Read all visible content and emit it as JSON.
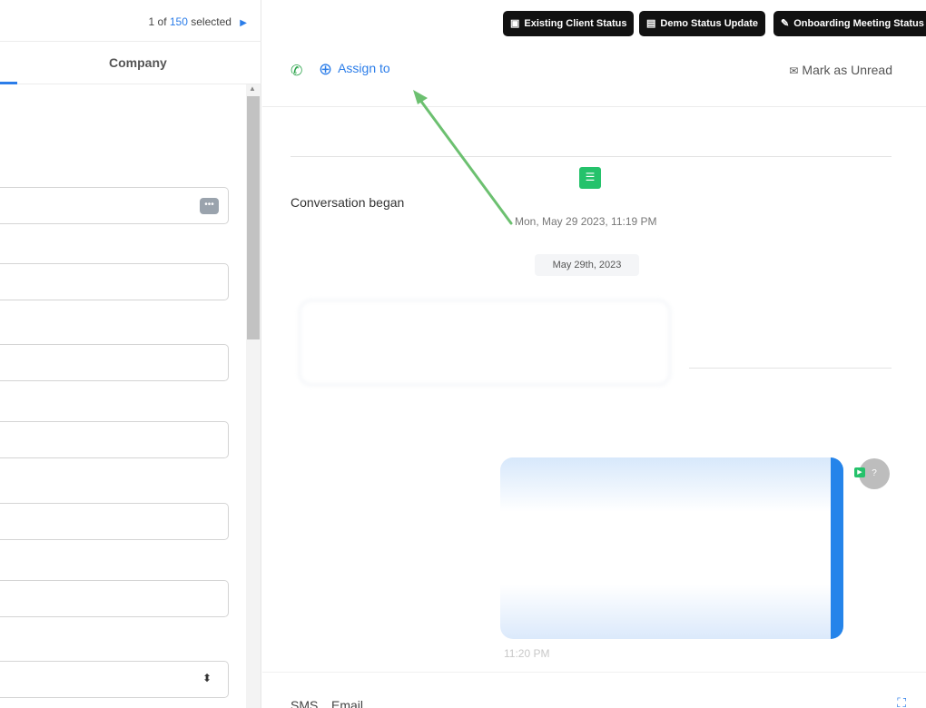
{
  "left_panel": {
    "selection": {
      "index": "1",
      "of_label": "of",
      "total": "150",
      "selected_label": "selected",
      "next_icon": "caret-right-icon"
    },
    "tabs": {
      "company_label": "Company"
    }
  },
  "status_buttons": [
    {
      "label": "Existing Client Status",
      "icon": "contact-card-icon"
    },
    {
      "label": "Demo Status Update",
      "icon": "id-card-icon"
    },
    {
      "label": "Onboarding Meeting Status",
      "icon": "wrench-icon"
    }
  ],
  "actions": {
    "assign_label": "Assign to",
    "mark_unread_label": "Mark as Unread"
  },
  "conversation": {
    "began_label": "Conversation began",
    "began_date": "Mon, May 29 2023, 11:19 PM",
    "date_chip": "May 29th, 2023",
    "message_time": "11:20 PM"
  },
  "composer": {
    "tabs": [
      "SMS",
      "Email"
    ]
  },
  "colors": {
    "accent": "#2b7de9",
    "green": "#25c26b",
    "annotation_arrow": "#6cc070",
    "bubble_bar": "#2584ea"
  }
}
